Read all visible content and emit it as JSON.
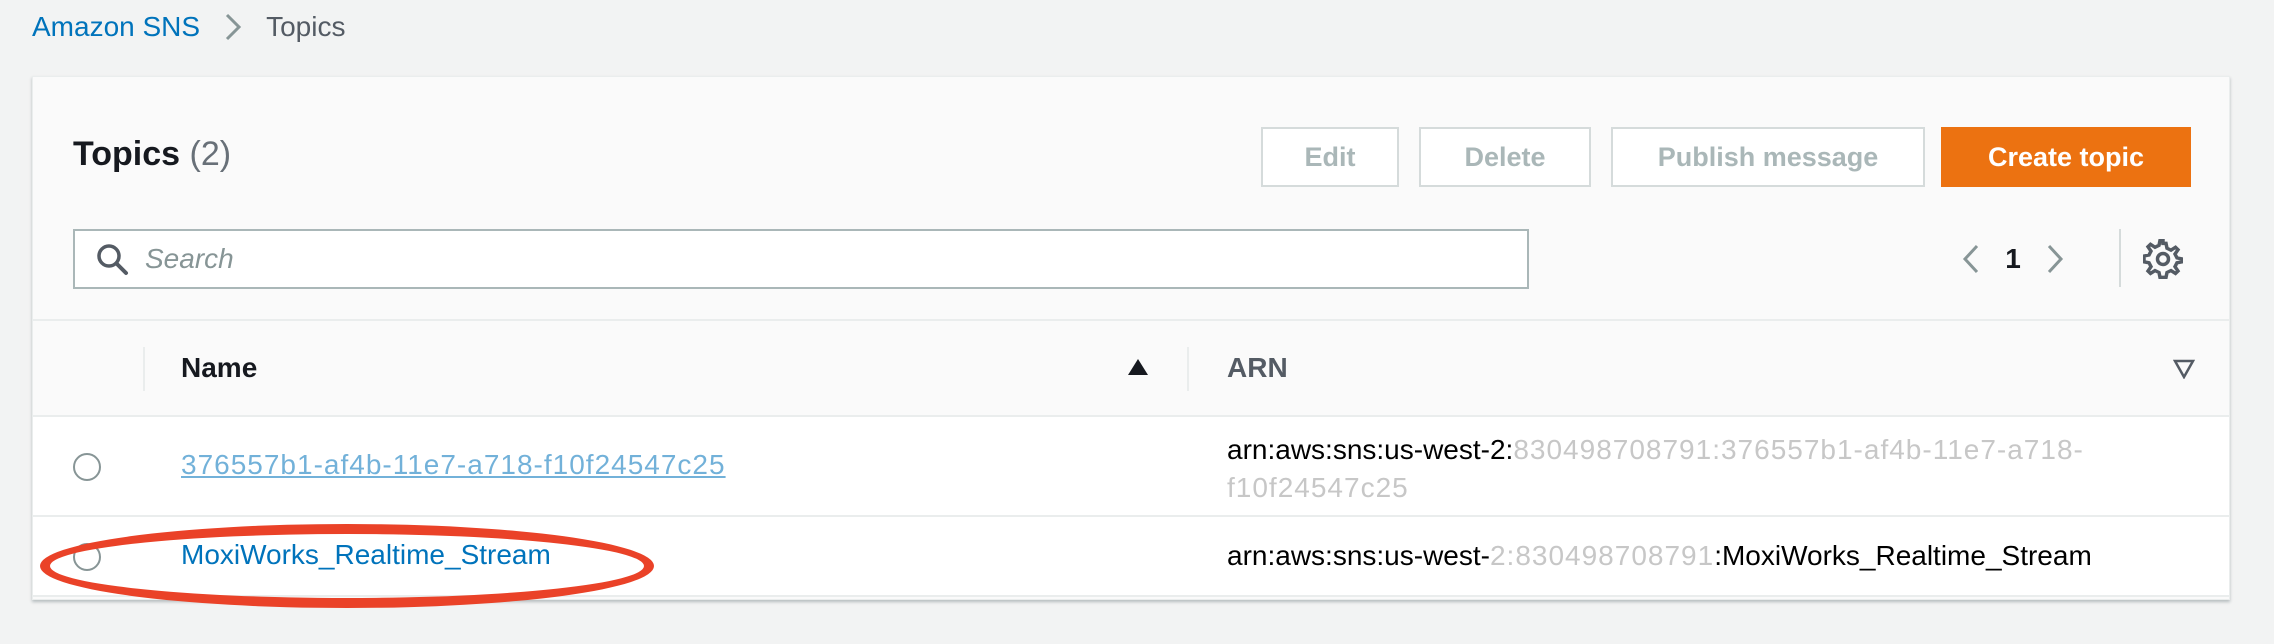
{
  "breadcrumb": {
    "root": "Amazon SNS",
    "current": "Topics"
  },
  "header": {
    "title": "Topics",
    "count": "(2)"
  },
  "actions": {
    "edit": "Edit",
    "delete": "Delete",
    "publish": "Publish message",
    "create": "Create topic"
  },
  "search": {
    "placeholder": "Search",
    "value": ""
  },
  "pagination": {
    "current_page": "1"
  },
  "table": {
    "columns": {
      "name": "Name",
      "arn": "ARN"
    },
    "sorted_by": "Name",
    "sort_direction": "ascending",
    "rows": [
      {
        "name": "376557b1-af4b-11e7-a718-f10f24547c25",
        "arn_prefix": "arn:aws:sns:us-west-2:",
        "arn_rest": "830498708791:376557b1-af4b-11e7-a718-f10f24547c25"
      },
      {
        "name": "MoxiWorks_Realtime_Stream",
        "arn_prefix": "arn:aws:sns:us-west-",
        "arn_redacted": "2:830498708791",
        "arn_suffix": ":MoxiWorks_Realtime_Stream"
      }
    ]
  },
  "colors": {
    "link": "#0073bb",
    "primary_button": "#ec7211",
    "annotation": "#ea4228",
    "background": "#f2f3f3"
  },
  "icons": {
    "breadcrumb_separator": "chevron-right-icon",
    "search": "search-icon",
    "prev_page": "chevron-left-icon",
    "next_page": "chevron-right-icon",
    "preferences": "gear-icon",
    "sort_asc": "caret-up-icon",
    "sort_none": "caret-down-outline-icon"
  }
}
